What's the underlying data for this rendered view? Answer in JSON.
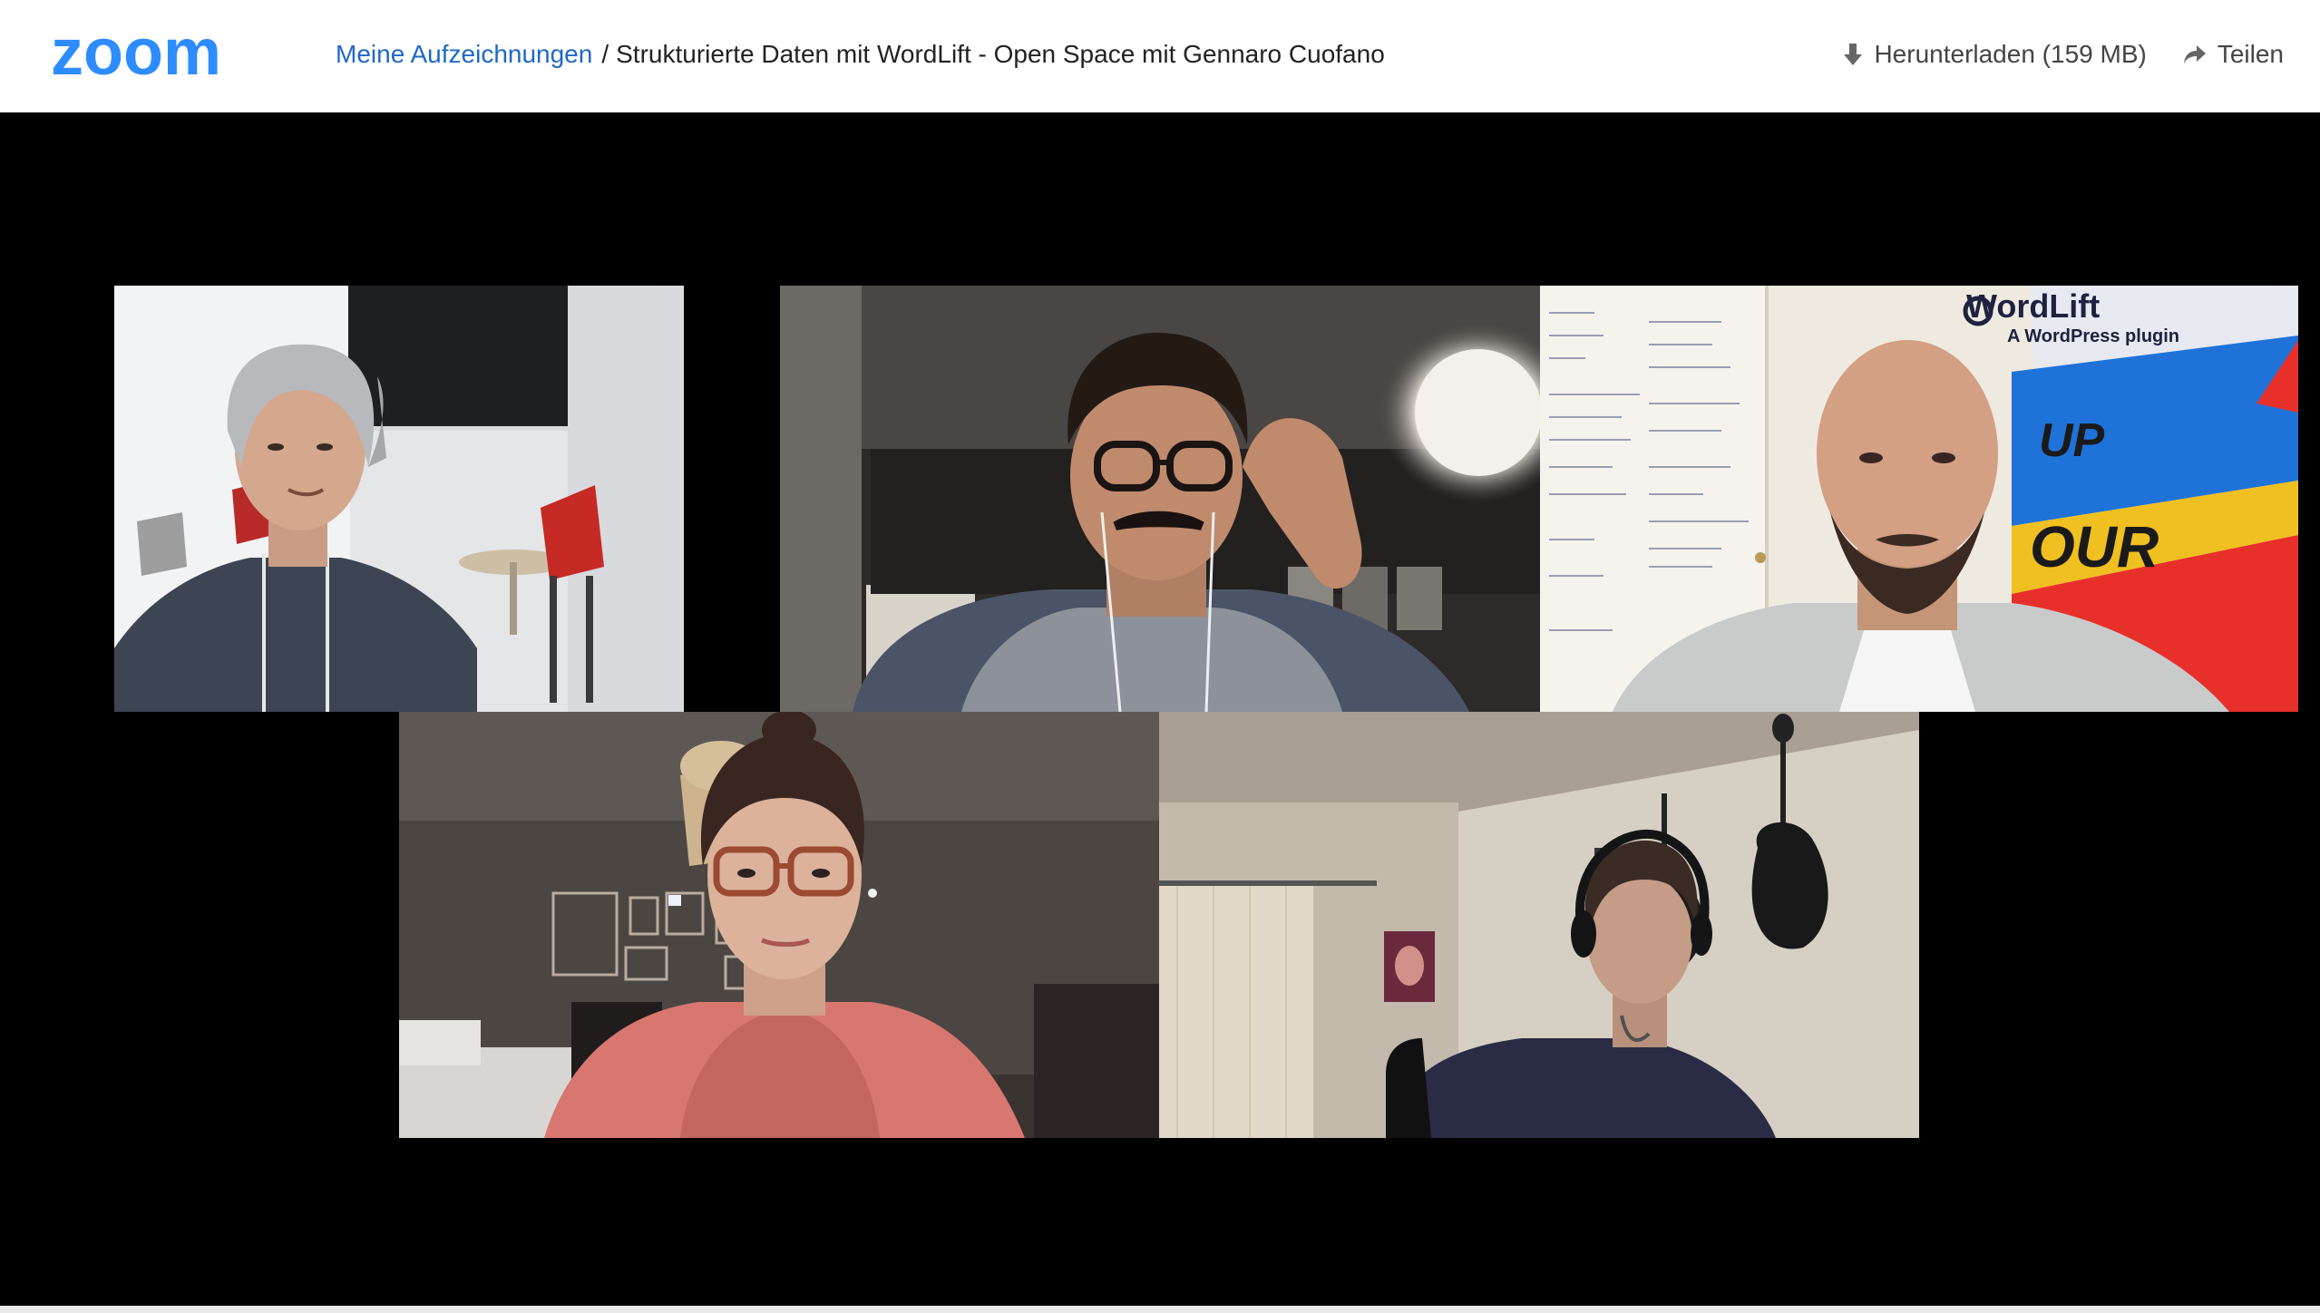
{
  "app": {
    "logo_text": "zoom",
    "accent_color": "#2D8CFF"
  },
  "breadcrumb": {
    "link_label": "Meine Aufzeichnungen",
    "separator": "/",
    "title": "Strukturierte Daten mit WordLift - Open Space mit Gennaro Cuofano"
  },
  "actions": {
    "download": {
      "label": "Herunterladen (159 MB)",
      "icon": "download-icon"
    },
    "share": {
      "label": "Teilen",
      "icon": "share-icon"
    }
  },
  "video": {
    "participants_visible": 5,
    "banner_lines": [
      "WordLift",
      "A WordPress plugin"
    ],
    "banner_letters": [
      "UP",
      "OUR"
    ]
  }
}
